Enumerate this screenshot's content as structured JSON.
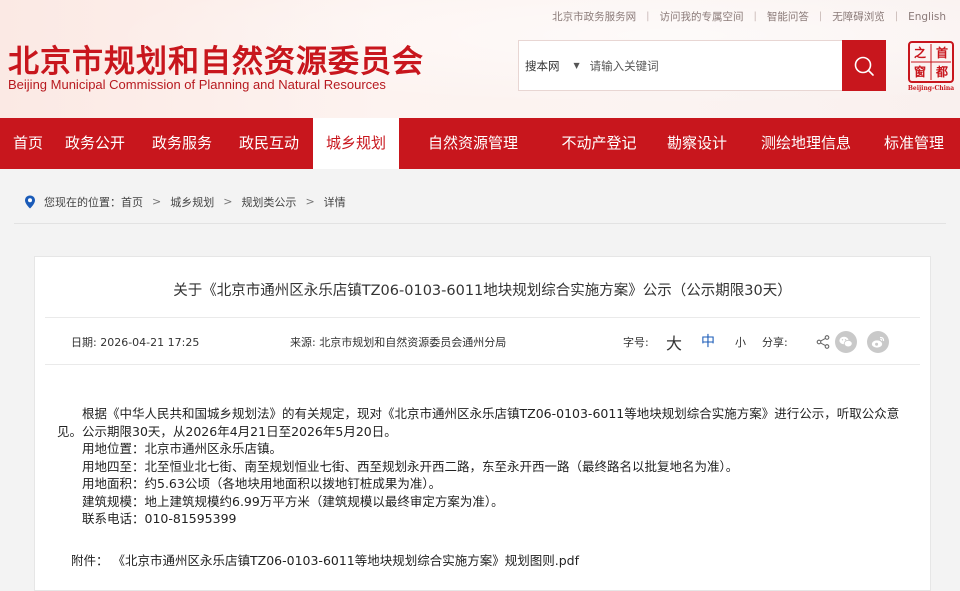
{
  "top_links": [
    "北京市政务服务网",
    "访问我的专属空间",
    "智能问答",
    "无障碍浏览",
    "English"
  ],
  "logo": {
    "title_cn": "北京市规划和自然资源委员会",
    "title_en": "Beijing Municipal Commission of Planning and Natural Resources"
  },
  "search": {
    "scope": "搜本网",
    "placeholder": "请输入关键词"
  },
  "seal": {
    "chars": [
      "首",
      "都",
      "之",
      "窗"
    ],
    "caption": "Beijing-China"
  },
  "nav": [
    "首页",
    "政务公开",
    "政务服务",
    "政民互动",
    "城乡规划",
    "自然资源管理",
    "不动产登记",
    "勘察设计",
    "测绘地理信息",
    "标准管理"
  ],
  "nav_active": "城乡规划",
  "breadcrumb": {
    "prefix": "您现在的位置：",
    "items": [
      "首页",
      "城乡规划",
      "规划类公示",
      "详情"
    ]
  },
  "article": {
    "title": "关于《北京市通州区永乐店镇TZ06-0103-6011地块规划综合实施方案》公示（公示期限30天）",
    "date": "日期:  2026-04-21 17:25",
    "source": "来源:  北京市规划和自然资源委员会通州分局",
    "font_size_label": "字号:",
    "font_large": "大",
    "font_medium": "中",
    "font_small": "小",
    "share_label": "分享:",
    "paragraph": "根据《中华人民共和国城乡规划法》的有关规定，现对《北京市通州区永乐店镇TZ06-0103-6011等地块规划综合实施方案》进行公示，听取公众意见。公示期限30天，从2026年4月21日至2026年5月20日。",
    "lines": [
      "用地位置：北京市通州区永乐店镇。",
      "用地四至：北至恒业北七街、南至规划恒业七街、西至规划永开西二路，东至永开西一路（最终路名以批复地名为准）。",
      "用地面积：约5.63公顷（各地块用地面积以拨地钉桩成果为准）。",
      "建筑规模：地上建筑规模约6.99万平方米（建筑规模以最终审定方案为准）。",
      "联系电话：010-81595399"
    ],
    "attachment_label": "附件：",
    "attachment": "《北京市通州区永乐店镇TZ06-0103-6011等地块规划综合实施方案》规划图则.pdf"
  },
  "colors": {
    "brand_red": "#c8161d",
    "accent_blue": "#1a5bb8"
  }
}
